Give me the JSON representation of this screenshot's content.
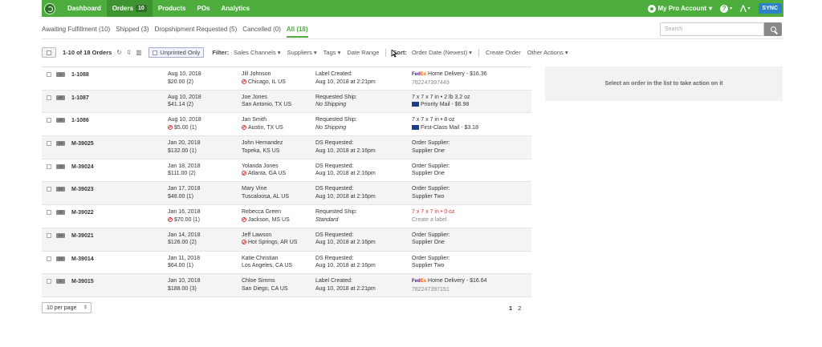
{
  "nav": {
    "items": [
      {
        "label": "Dashboard"
      },
      {
        "label": "Orders",
        "badge": "10"
      },
      {
        "label": "Products"
      },
      {
        "label": "POs"
      },
      {
        "label": "Analytics"
      }
    ],
    "account": "My Pro Account",
    "help": "?",
    "sync": "SYNC"
  },
  "tabs": [
    {
      "label": "Awaiting Fulfillment (10)"
    },
    {
      "label": "Shipped (3)"
    },
    {
      "label": "Dropshipment Requested (5)"
    },
    {
      "label": "Cancelled (0)"
    },
    {
      "label": "All (18)"
    }
  ],
  "search": {
    "placeholder": "Search"
  },
  "toolbar": {
    "count": "1-10 of 18 Orders",
    "unprinted": "Unprinted Only",
    "filter_label": "Filter:",
    "filters": [
      "Sales Channels ▾",
      "Suppliers ▾",
      "Tags ▾",
      "Date Range"
    ],
    "sort_label": "Sort:",
    "sort_value": "Order Date (Newest) ▾",
    "create_order": "Create Order",
    "other_actions": "Other Actions ▾"
  },
  "orders": [
    {
      "tag": "S",
      "number": "1-1088",
      "date": "Aug 10, 2018",
      "amount": "$20.00 (2)",
      "amount_flag": false,
      "name": "Jill Johnson",
      "location": "Chicago, IL US",
      "loc_flag": true,
      "status_label": "Label Created:",
      "status_value": "Aug 10, 2018 at 2:21pm",
      "status_italic": false,
      "ship_line1": "Home Delivery - $16.36",
      "ship_line2": "782247397449",
      "carrier": "fedex"
    },
    {
      "tag": "AF",
      "number": "1-1087",
      "date": "Aug 10, 2018",
      "amount": "$41.14 (2)",
      "amount_flag": false,
      "name": "Joe Jones",
      "location": "San Antonio, TX US",
      "loc_flag": false,
      "status_label": "Requested Ship:",
      "status_value": "No Shipping",
      "status_italic": true,
      "ship_line1": "7 x 7 x 7 in  •  2 lb  3.2 oz",
      "ship_line2": "Priority Mail - $6.98",
      "carrier": "usps"
    },
    {
      "tag": "AF",
      "number": "1-1086",
      "date": "Aug 10, 2018",
      "amount": "$5.00 (1)",
      "amount_flag": true,
      "name": "Jan Smith",
      "location": "Austin, TX US",
      "loc_flag": true,
      "status_label": "Requested Ship:",
      "status_value": "No Shipping",
      "status_italic": true,
      "ship_line1": "7 x 7 x 7 in  •  8 oz",
      "ship_line2": "First-Class Mail - $3.18",
      "carrier": "usps"
    },
    {
      "tag": "DS",
      "number": "M-39025",
      "date": "Jan 20, 2018",
      "amount": "$132.00 (1)",
      "amount_flag": false,
      "name": "John Hernandez",
      "location": "Topeka, KS US",
      "loc_flag": false,
      "status_label": "DS Requested:",
      "status_value": "Aug 10, 2018 at 2:16pm",
      "status_italic": false,
      "ship_line1": "Order Supplier:",
      "ship_line2": "Supplier One",
      "carrier": "supplier"
    },
    {
      "tag": "DS",
      "number": "M-39024",
      "date": "Jan 18, 2018",
      "amount": "$111.00 (2)",
      "amount_flag": false,
      "name": "Yolanda Jones",
      "location": "Atlanta, GA US",
      "loc_flag": true,
      "status_label": "DS Requested:",
      "status_value": "Aug 10, 2018 at 2:16pm",
      "status_italic": false,
      "ship_line1": "Order Supplier:",
      "ship_line2": "Supplier One",
      "carrier": "supplier"
    },
    {
      "tag": "DS",
      "number": "M-39023",
      "date": "Jan 17, 2018",
      "amount": "$48.00 (1)",
      "amount_flag": false,
      "name": "Mary Vine",
      "location": "Tuscaloosa, AL US",
      "loc_flag": false,
      "status_label": "DS Requested:",
      "status_value": "Aug 10, 2018 at 2:16pm",
      "status_italic": false,
      "ship_line1": "Order Supplier:",
      "ship_line2": "Supplier Two",
      "carrier": "supplier"
    },
    {
      "tag": "AF",
      "number": "M-39022",
      "date": "Jan 16, 2018",
      "amount": "$70.00 (1)",
      "amount_flag": true,
      "name": "Rebecca Green",
      "location": "Jackson, MS US",
      "loc_flag": true,
      "status_label": "Requested Ship:",
      "status_value": "Standard",
      "status_italic": true,
      "ship_line1": "7 x 7 x 7 in  •  0 oz",
      "ship_line2": "Create a label",
      "carrier": "none"
    },
    {
      "tag": "DS",
      "number": "M-39021",
      "date": "Jan 14, 2018",
      "amount": "$126.00 (2)",
      "amount_flag": false,
      "name": "Jeff Lawson",
      "location": "Hot Springs, AR US",
      "loc_flag": true,
      "status_label": "DS Requested:",
      "status_value": "Aug 10, 2018 at 2:16pm",
      "status_italic": false,
      "ship_line1": "Order Supplier:",
      "ship_line2": "Supplier One",
      "carrier": "supplier"
    },
    {
      "tag": "DS",
      "number": "M-39014",
      "date": "Jan 11, 2018",
      "amount": "$64.00 (1)",
      "amount_flag": false,
      "name": "Katie Christian",
      "location": "Los Angeles, CA US",
      "loc_flag": false,
      "status_label": "DS Requested:",
      "status_value": "Aug 10, 2018 at 2:16pm",
      "status_italic": false,
      "ship_line1": "Order Supplier:",
      "ship_line2": "Supplier Two",
      "carrier": "supplier"
    },
    {
      "tag": "S",
      "number": "M-39015",
      "date": "Jan 10, 2018",
      "amount": "$188.00 (3)",
      "amount_flag": false,
      "name": "Chloe Simms",
      "location": "San Diego, CA US",
      "loc_flag": false,
      "status_label": "Label Created:",
      "status_value": "Aug 10, 2018 at 2:21pm",
      "status_italic": false,
      "ship_line1": "Home Delivery - $16.64",
      "ship_line2": "782247397151",
      "carrier": "fedex"
    }
  ],
  "panel": {
    "message": "Select an order in the list to take action on it"
  },
  "footer": {
    "per_page": "10 per page",
    "pages": [
      "1",
      "2"
    ]
  },
  "colors": {
    "brand_green": "#4dae3e",
    "sync_blue": "#2b82c8",
    "alert_red": "#dd3333"
  }
}
